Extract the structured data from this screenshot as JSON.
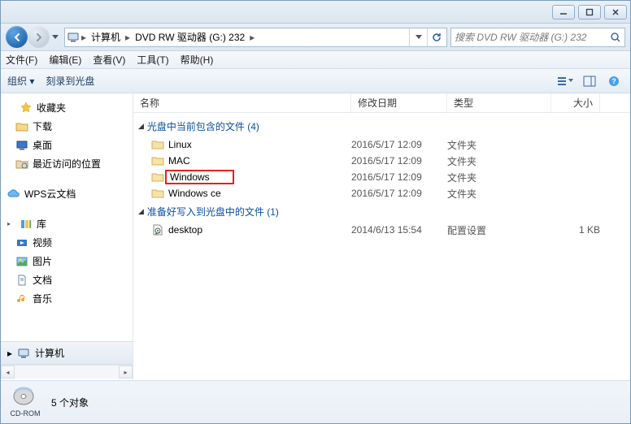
{
  "window": {
    "minimize": "—",
    "maximize": "□",
    "close": "✕"
  },
  "addressbar": {
    "computer_icon": "computer",
    "segments": [
      "计算机",
      "DVD RW 驱动器 (G:) 232"
    ],
    "refresh": "↻"
  },
  "search": {
    "placeholder": "搜索 DVD RW 驱动器 (G:) 232"
  },
  "menu": {
    "file": "文件(F)",
    "edit": "编辑(E)",
    "view": "查看(V)",
    "tools": "工具(T)",
    "help": "帮助(H)"
  },
  "toolbar": {
    "organize": "组织",
    "burn": "刻录到光盘"
  },
  "sidebar": {
    "favorites": {
      "head": "收藏夹",
      "items": [
        "下载",
        "桌面",
        "最近访问的位置"
      ]
    },
    "wps": "WPS云文档",
    "libraries": {
      "head": "库",
      "items": [
        "视频",
        "图片",
        "文档",
        "音乐"
      ]
    },
    "computer": "计算机"
  },
  "columns": {
    "name": "名称",
    "date": "修改日期",
    "type": "类型",
    "size": "大小"
  },
  "sections": [
    {
      "title": "光盘中当前包含的文件 (4)",
      "rows": [
        {
          "name": "Linux",
          "date": "2016/5/17 12:09",
          "type": "文件夹",
          "size": "",
          "icon": "folder"
        },
        {
          "name": "MAC",
          "date": "2016/5/17 12:09",
          "type": "文件夹",
          "size": "",
          "icon": "folder"
        },
        {
          "name": "Windows",
          "date": "2016/5/17 12:09",
          "type": "文件夹",
          "size": "",
          "icon": "folder",
          "highlight": true
        },
        {
          "name": "Windows ce",
          "date": "2016/5/17 12:09",
          "type": "文件夹",
          "size": "",
          "icon": "folder"
        }
      ]
    },
    {
      "title": "准备好写入到光盘中的文件 (1)",
      "rows": [
        {
          "name": "desktop",
          "date": "2014/6/13 15:54",
          "type": "配置设置",
          "size": "1 KB",
          "icon": "ini"
        }
      ]
    }
  ],
  "footer": {
    "drive_label": "CD-ROM",
    "count": "5 个对象"
  }
}
